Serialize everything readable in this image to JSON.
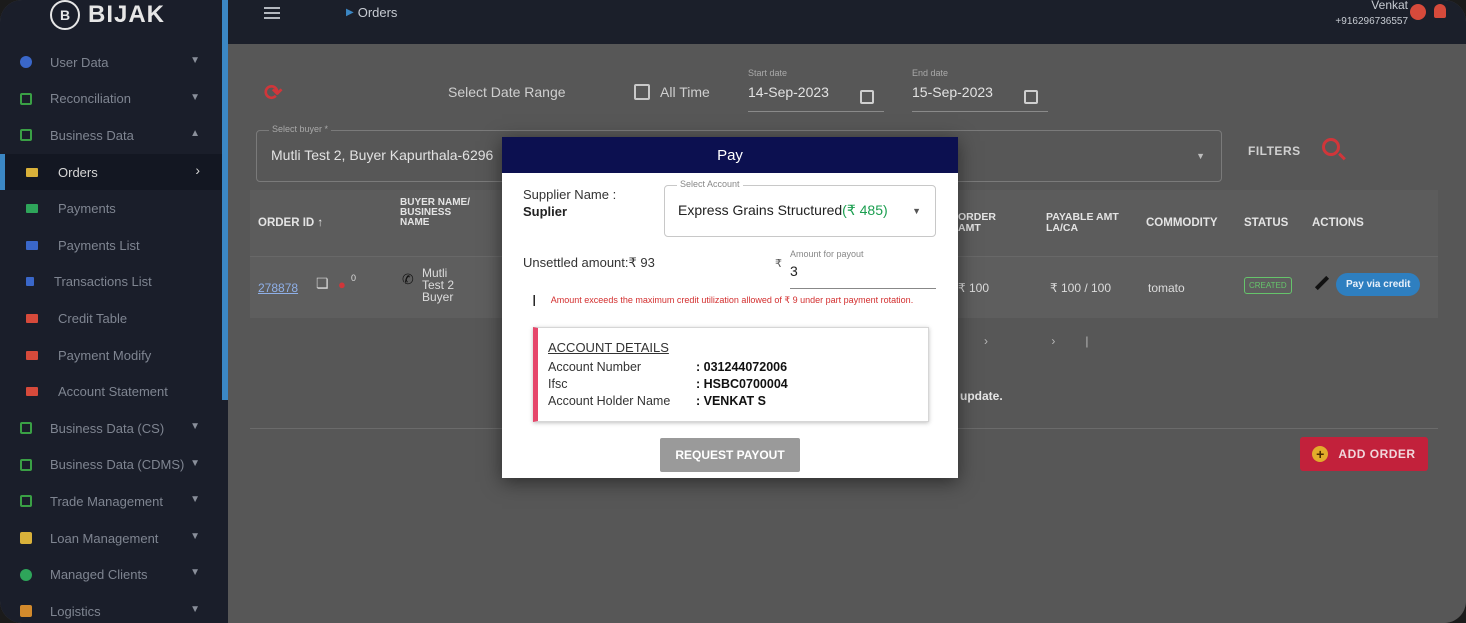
{
  "app": {
    "brand": "BIJAK",
    "brand_mark": "B"
  },
  "topbar": {
    "breadcrumb": "Orders",
    "user_name": "Venkat",
    "user_phone": "+916296736557"
  },
  "sidebar": {
    "items": [
      {
        "label": "User Data",
        "icon": "globe-icon"
      },
      {
        "label": "Reconciliation",
        "icon": "grid-icon"
      },
      {
        "label": "Business Data",
        "icon": "grid-icon"
      },
      {
        "label": "Orders",
        "icon": "orders-icon",
        "color": "#d9b13a"
      },
      {
        "label": "Payments",
        "icon": "payments-icon",
        "color": "#2ea55a"
      },
      {
        "label": "Payments List",
        "icon": "payments-list-icon",
        "color": "#3a67c9"
      },
      {
        "label": "Transactions List",
        "icon": "transactions-icon",
        "color": "#3a67c9"
      },
      {
        "label": "Credit Table",
        "icon": "credit-table-icon",
        "color": "#d64a3b"
      },
      {
        "label": "Payment Modify",
        "icon": "payment-modify-icon",
        "color": "#d64a3b"
      },
      {
        "label": "Account Statement",
        "icon": "account-statement-icon",
        "color": "#d64a3b"
      },
      {
        "label": "Business Data (CS)",
        "icon": "grid-icon"
      },
      {
        "label": "Business Data (CDMS)",
        "icon": "grid-icon"
      },
      {
        "label": "Trade Management",
        "icon": "grid-icon"
      },
      {
        "label": "Loan Management",
        "icon": "lock-icon"
      },
      {
        "label": "Managed Clients",
        "icon": "globe-icon"
      },
      {
        "label": "Logistics",
        "icon": "truck-icon"
      }
    ]
  },
  "filters": {
    "date_range_label": "Select Date Range",
    "all_time_label": "All Time",
    "start_label": "Start date",
    "start_value": "14-Sep-2023",
    "end_label": "End date",
    "end_value": "15-Sep-2023",
    "buyer_label": "Select buyer *",
    "buyer_value": "Mutli Test 2, Buyer Kapurthala-6296",
    "filters_label": "FILTERS"
  },
  "table": {
    "headers": {
      "order_id": "ORDER ID ↑",
      "buyer": "BUYER NAME/ BUSINESS NAME",
      "order_amt": "ORDER AMT",
      "payable": "PAYABLE AMT LA/CA",
      "commodity": "COMMODITY",
      "status": "STATUS",
      "actions": "ACTIONS"
    },
    "row": {
      "order_id": "278878",
      "count": "0",
      "buyer": "Mutli Test 2 Buyer",
      "order_amt": "₹ 100",
      "payable": "₹ 100 / 100",
      "commodity": "tomato",
      "status": "CREATED",
      "action": "Pay via credit"
    },
    "pager": "›  ›|",
    "notice": "update.",
    "add_order": "ADD ORDER"
  },
  "modal": {
    "title": "Pay",
    "supplier_label": "Supplier Name :",
    "supplier_value": "Suplier",
    "account_label": "Select Account",
    "account_value": "Express Grains Structured",
    "account_amount": "(₹ 485)",
    "unsettled": "Unsettled amount:₹ 93",
    "rupee": "₹",
    "amount_label": "Amount for payout",
    "amount_value": "3",
    "error": "Amount exceeds the maximum credit utilization allowed of ₹ 9 under part payment rotation.",
    "account_details_title": "ACCOUNT DETAILS",
    "account_number_label": "Account Number",
    "account_number_value": ": 031244072006",
    "ifsc_label": "Ifsc",
    "ifsc_value": ": HSBC0700004",
    "holder_label": "Account Holder Name",
    "holder_value": ": VENKAT S",
    "request_button": "REQUEST PAYOUT"
  }
}
